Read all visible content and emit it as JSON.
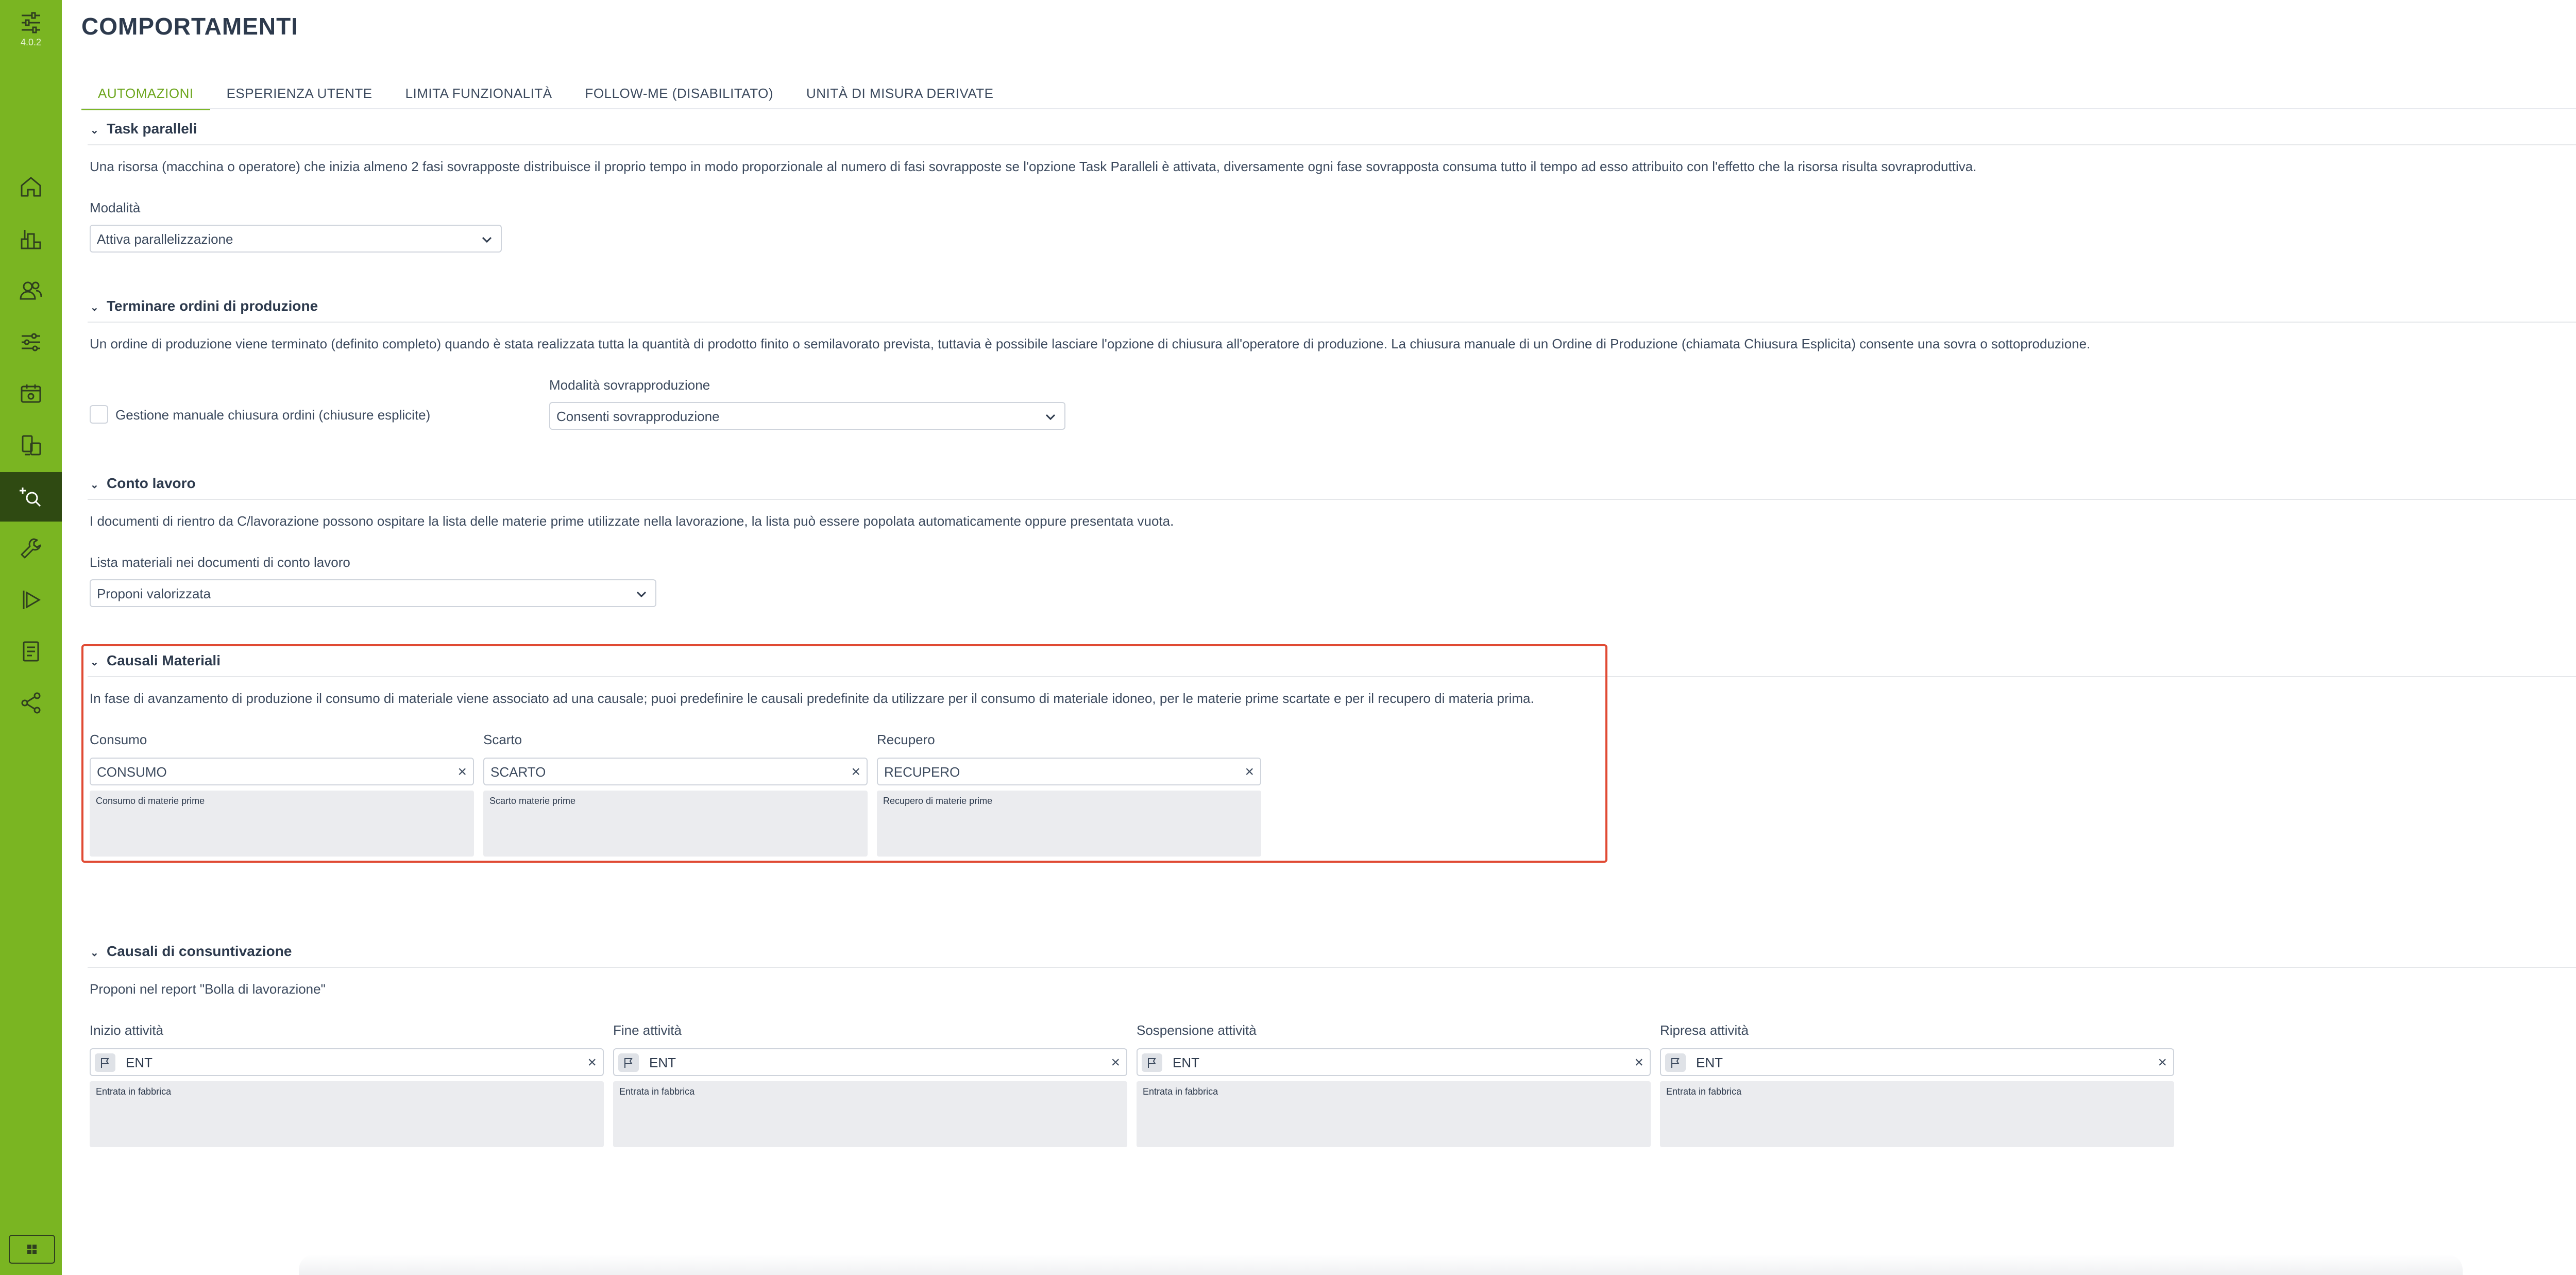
{
  "app": {
    "version": "4.0.2",
    "title": "COMPORTAMENTI"
  },
  "sidebar": {
    "items": [
      {
        "icon": "home-icon"
      },
      {
        "icon": "factory-icon"
      },
      {
        "icon": "users-icon"
      },
      {
        "icon": "sliders-icon"
      },
      {
        "icon": "calendar-icon"
      },
      {
        "icon": "devices-icon"
      },
      {
        "icon": "behaviours-icon",
        "active": true
      },
      {
        "icon": "wrench-icon"
      },
      {
        "icon": "play-icon"
      },
      {
        "icon": "document-icon"
      },
      {
        "icon": "share-icon"
      }
    ]
  },
  "tabs": [
    "AUTOMAZIONI",
    "ESPERIENZA UTENTE",
    "LIMITA FUNZIONALITÀ",
    "FOLLOW-ME (DISABILITATO)",
    "UNITÀ DI MISURA DERIVATE"
  ],
  "task_paralleli": {
    "title": "Task paralleli",
    "description": "Una risorsa (macchina o operatore) che inizia almeno 2 fasi sovrapposte distribuisce il proprio tempo in modo proporzionale al numero di fasi sovrapposte se l'opzione Task Paralleli è attivata, diversamente ogni fase sovrapposta consuma tutto il tempo ad esso attribuito con l'effetto che la risorsa risulta sovraproduttiva.",
    "mode_label": "Modalità",
    "mode_value": "Attiva parallelizzazione"
  },
  "terminare": {
    "title": "Terminare ordini di produzione",
    "description": "Un ordine di produzione viene terminato (definito completo) quando è stata realizzata tutta la quantità di prodotto finito o semilavorato prevista, tuttavia è possibile lasciare l'opzione di chiusura all'operatore di produzione. La chiusura manuale di un Ordine di Produzione (chiamata Chiusura Esplicita) consente una sovra o sottoproduzione.",
    "checkbox_label": "Gestione manuale chiusura ordini (chiusure esplicite)",
    "over_label": "Modalità sovrapproduzione",
    "over_value": "Consenti sovrapproduzione"
  },
  "conto_lavoro": {
    "title": "Conto lavoro",
    "description": "I documenti di rientro da C/lavorazione possono ospitare la lista delle materie prime utilizzate nella lavorazione, la lista può essere popolata automaticamente oppure presentata vuota.",
    "list_label": "Lista materiali nei documenti di conto lavoro",
    "list_value": "Proponi valorizzata"
  },
  "causali_materiali": {
    "title": "Causali Materiali",
    "description": "In fase di avanzamento di produzione il consumo di materiale viene associato ad una causale; puoi predefinire le causali predefinite da utilizzare per il consumo di materiale idoneo, per le materie prime scartate e per il recupero di materia prima.",
    "fields": [
      {
        "label": "Consumo",
        "value": "CONSUMO",
        "detail": "Consumo di materie prime"
      },
      {
        "label": "Scarto",
        "value": "SCARTO",
        "detail": "Scarto materie prime"
      },
      {
        "label": "Recupero",
        "value": "RECUPERO",
        "detail": "Recupero di materie prime"
      }
    ]
  },
  "causali_consuntivazione": {
    "title": "Causali di consuntivazione",
    "description": "Proponi nel report \"Bolla di lavorazione\"",
    "fields": [
      {
        "label": "Inizio attività",
        "value": "ENT",
        "detail": "Entrata in fabbrica"
      },
      {
        "label": "Fine attività",
        "value": "ENT",
        "detail": "Entrata in fabbrica"
      },
      {
        "label": "Sospensione attività",
        "value": "ENT",
        "detail": "Entrata in fabbrica"
      },
      {
        "label": "Ripresa attività",
        "value": "ENT",
        "detail": "Entrata in fabbrica"
      }
    ]
  },
  "colors": {
    "accent": "#7ab522",
    "active_nav": "#2f4a12",
    "highlight": "#e04a33",
    "notification": "#f5a623"
  }
}
